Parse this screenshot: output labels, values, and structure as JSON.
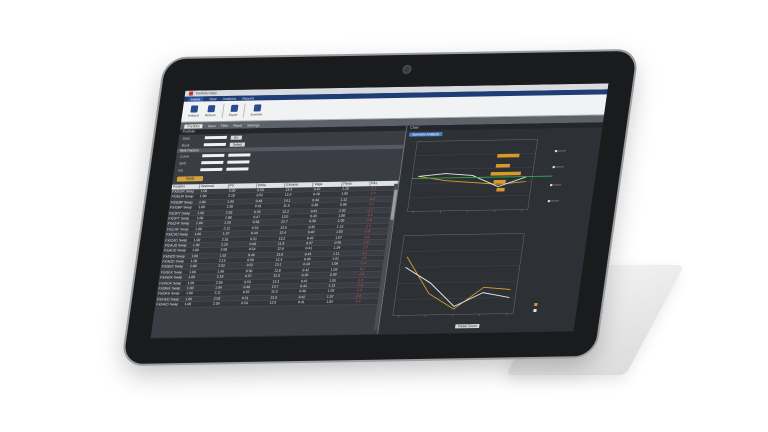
{
  "window": {
    "title": "Portfolio View"
  },
  "ribbon": {
    "tabs": [
      {
        "label": "Home",
        "active": true
      },
      {
        "label": "View",
        "active": false
      },
      {
        "label": "Analytics",
        "active": false
      },
      {
        "label": "Reports",
        "active": false
      }
    ],
    "buttons": [
      {
        "label": "Analysis",
        "icon": "analysis-icon"
      },
      {
        "label": "Refresh",
        "icon": "refresh-icon"
      },
      {
        "label": "Export",
        "icon": "export-icon"
      },
      {
        "label": "Scenario",
        "icon": "scenario-icon"
      }
    ]
  },
  "toolbar": {
    "field_value": "Portfolio",
    "buttons": [
      "Save",
      "Filter",
      "Reset",
      "Settings"
    ]
  },
  "left_panel": {
    "header": "Portfolio",
    "form_rows": [
      {
        "label": "Date",
        "button": "Go"
      },
      {
        "label": "Book",
        "button": "Select"
      }
    ],
    "section": "Risk Factors",
    "section_rows": [
      {
        "label": "Curve"
      },
      {
        "label": "Shift"
      },
      {
        "label": "Vol"
      }
    ],
    "apply_label": "Apply",
    "grid_columns": [
      "Position",
      "Notional",
      "PV",
      "Delta",
      "Gamma",
      "Vega",
      "Theta",
      "P&L"
    ],
    "grid_rows": [
      [
        "FX/EUR Swap",
        "1.00",
        "2.00",
        "0.50",
        "13.4",
        "0.42",
        "1.10",
        "-1.2"
      ],
      [
        "FX/EUR Swap",
        "1.00",
        "2.10",
        "0.52",
        "12.9",
        "0.40",
        "1.05",
        "-2.4"
      ],
      [
        "FX/GBP Swap",
        "1.00",
        "1.95",
        "0.48",
        "14.1",
        "0.44",
        "1.12",
        "-0.8"
      ],
      [
        "FX/GBP Swap",
        "1.00",
        "2.30",
        "0.61",
        "11.5",
        "0.38",
        "0.98",
        "-3.1"
      ],
      [
        "FX/JPY Swap",
        "1.00",
        "2.05",
        "0.55",
        "12.2",
        "0.41",
        "1.02",
        "-1.7"
      ],
      [
        "FX/JPY Swap",
        "1.00",
        "1.88",
        "0.47",
        "13.0",
        "0.43",
        "1.08",
        "-0.6"
      ],
      [
        "FX/CHF Swap",
        "1.00",
        "2.20",
        "0.58",
        "12.7",
        "0.39",
        "1.00",
        "-2.0"
      ],
      [
        "FX/CHF Swap",
        "1.00",
        "2.12",
        "0.53",
        "13.6",
        "0.45",
        "1.15",
        "-1.5"
      ],
      [
        "FX/CAD Swap",
        "1.00",
        "1.97",
        "0.49",
        "12.4",
        "0.40",
        "1.03",
        "-2.8"
      ],
      [
        "FX/CAD Swap",
        "1.00",
        "2.01",
        "0.51",
        "13.2",
        "0.42",
        "1.07",
        "-0.9"
      ],
      [
        "FX/AUD Swap",
        "1.00",
        "2.25",
        "0.60",
        "11.8",
        "0.37",
        "0.95",
        "-1.9"
      ],
      [
        "FX/AUD Swap",
        "1.00",
        "2.08",
        "0.54",
        "12.6",
        "0.41",
        "1.04",
        "-2.2"
      ],
      [
        "FX/NZD Swap",
        "1.00",
        "1.92",
        "0.46",
        "13.8",
        "0.44",
        "1.11",
        "-1.1"
      ],
      [
        "FX/NZD Swap",
        "1.00",
        "2.15",
        "0.56",
        "12.3",
        "0.40",
        "1.01",
        "-2.6"
      ],
      [
        "FX/SEK Swap",
        "1.00",
        "2.02",
        "0.52",
        "13.1",
        "0.43",
        "1.06",
        "-1.4"
      ],
      [
        "FX/SEK Swap",
        "1.00",
        "1.99",
        "0.50",
        "12.8",
        "0.42",
        "1.09",
        "-0.7"
      ],
      [
        "FX/NOK Swap",
        "1.00",
        "2.18",
        "0.57",
        "12.0",
        "0.39",
        "0.99",
        "-2.9"
      ],
      [
        "FX/NOK Swap",
        "1.00",
        "2.06",
        "0.53",
        "13.3",
        "0.41",
        "1.05",
        "-1.6"
      ],
      [
        "FX/DKK Swap",
        "1.00",
        "1.94",
        "0.48",
        "13.7",
        "0.44",
        "1.13",
        "-1.0"
      ],
      [
        "FX/DKK Swap",
        "1.00",
        "2.11",
        "0.55",
        "12.5",
        "0.40",
        "1.02",
        "-2.3"
      ],
      [
        "FX/HKD Swap",
        "1.00",
        "2.03",
        "0.51",
        "13.0",
        "0.42",
        "1.07",
        "-1.8"
      ],
      [
        "FX/HKD Swap",
        "1.00",
        "2.09",
        "0.54",
        "12.9",
        "0.41",
        "1.04",
        "-1.3"
      ]
    ]
  },
  "right_panel": {
    "header": "Chart",
    "tab_label": "Scenario Analysis",
    "reset_label": "Reset Zoom"
  },
  "colors": {
    "series_a": "#d89b2a",
    "series_b": "#e6e6e6",
    "marker": "#2fb24a",
    "accent": "#1e3d77"
  },
  "chart_data": [
    {
      "type": "line",
      "x": [
        1,
        2,
        3,
        4,
        5
      ],
      "series": [
        {
          "values": [
            15,
            13,
            12,
            11,
            12
          ]
        },
        {
          "values": [
            15,
            16,
            15,
            10,
            14
          ]
        }
      ],
      "ylim": [
        0,
        30
      ]
    },
    {
      "type": "line",
      "x": [
        1,
        2,
        3,
        4,
        5
      ],
      "series": [
        {
          "values": [
            22,
            8,
            2,
            10,
            9
          ]
        },
        {
          "values": [
            18,
            12,
            3,
            8,
            6
          ]
        }
      ],
      "ylim": [
        0,
        30
      ]
    }
  ]
}
